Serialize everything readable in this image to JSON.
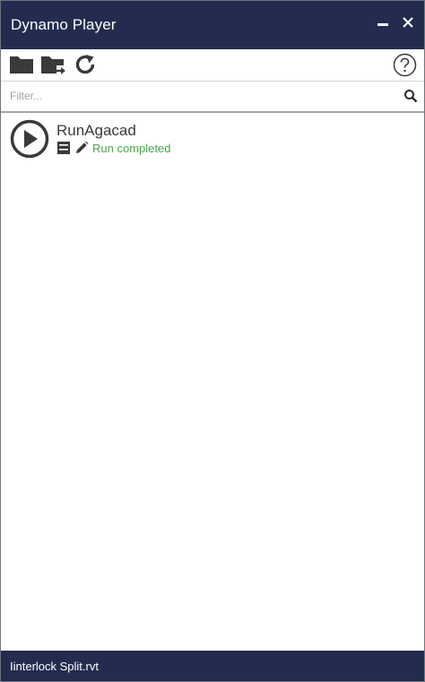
{
  "window": {
    "title": "Dynamo Player"
  },
  "toolbar": {
    "open_folder_icon": "folder-icon",
    "export_folder_icon": "folder-export-icon",
    "refresh_icon": "refresh-icon",
    "help_icon": "help-icon"
  },
  "filter": {
    "placeholder": "Filter...",
    "value": ""
  },
  "scripts": [
    {
      "name": "RunAgacad",
      "status": "Run completed"
    }
  ],
  "status_bar": {
    "file_name": "Iinterlock Split.rvt"
  },
  "colors": {
    "title_bar": "#232c4f",
    "status_success": "#4aa64a",
    "icon_dark": "#3a3a3a"
  }
}
